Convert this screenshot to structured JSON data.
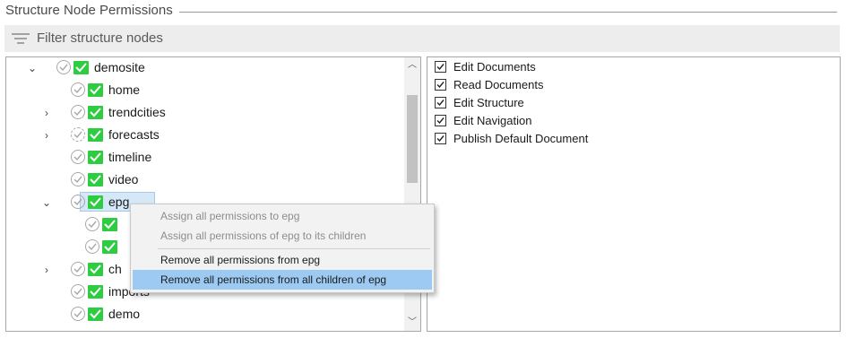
{
  "title": "Structure Node Permissions",
  "filter": {
    "placeholder": "Filter structure nodes"
  },
  "tree": {
    "nodes": [
      {
        "label": "demosite",
        "expander": "⌄",
        "dashed": false
      },
      {
        "label": "home",
        "expander": "",
        "dashed": false
      },
      {
        "label": "trendcities",
        "expander": "›",
        "dashed": false
      },
      {
        "label": "forecasts",
        "expander": "›",
        "dashed": true
      },
      {
        "label": "timeline",
        "expander": "",
        "dashed": false
      },
      {
        "label": "video",
        "expander": "",
        "dashed": false
      },
      {
        "label": "epg",
        "expander": "⌄",
        "dashed": false,
        "selected": true
      },
      {
        "label": "",
        "expander": "",
        "dashed": false
      },
      {
        "label": "",
        "expander": "",
        "dashed": false
      },
      {
        "label": "ch",
        "expander": "›",
        "dashed": false
      },
      {
        "label": "imports",
        "expander": "",
        "dashed": false
      },
      {
        "label": "demo",
        "expander": "",
        "dashed": false
      }
    ]
  },
  "permissions": [
    {
      "label": "Edit Documents",
      "checked": true
    },
    {
      "label": "Read Documents",
      "checked": true
    },
    {
      "label": "Edit Structure",
      "checked": true
    },
    {
      "label": "Edit Navigation",
      "checked": true
    },
    {
      "label": "Publish Default Document",
      "checked": true
    }
  ],
  "context_menu": {
    "items": [
      {
        "label": "Assign all permissions to epg",
        "enabled": false
      },
      {
        "label": "Assign all permissions of epg to its children",
        "enabled": false
      },
      {
        "label": "Remove all permissions from epg",
        "enabled": true
      },
      {
        "label": "Remove all permissions from all children of epg",
        "enabled": true,
        "highlighted": true
      }
    ]
  },
  "icons": {
    "filter": "filter-lines-icon",
    "node_status": "circle-check-icon",
    "node_permission": "green-check-icon",
    "scroll_up": "chevron-up-icon",
    "scroll_down": "chevron-down-icon"
  },
  "colors": {
    "permission_green": "#2ecc40",
    "selection": "#d5e8f8",
    "menu_highlight": "#9ccaf3"
  }
}
